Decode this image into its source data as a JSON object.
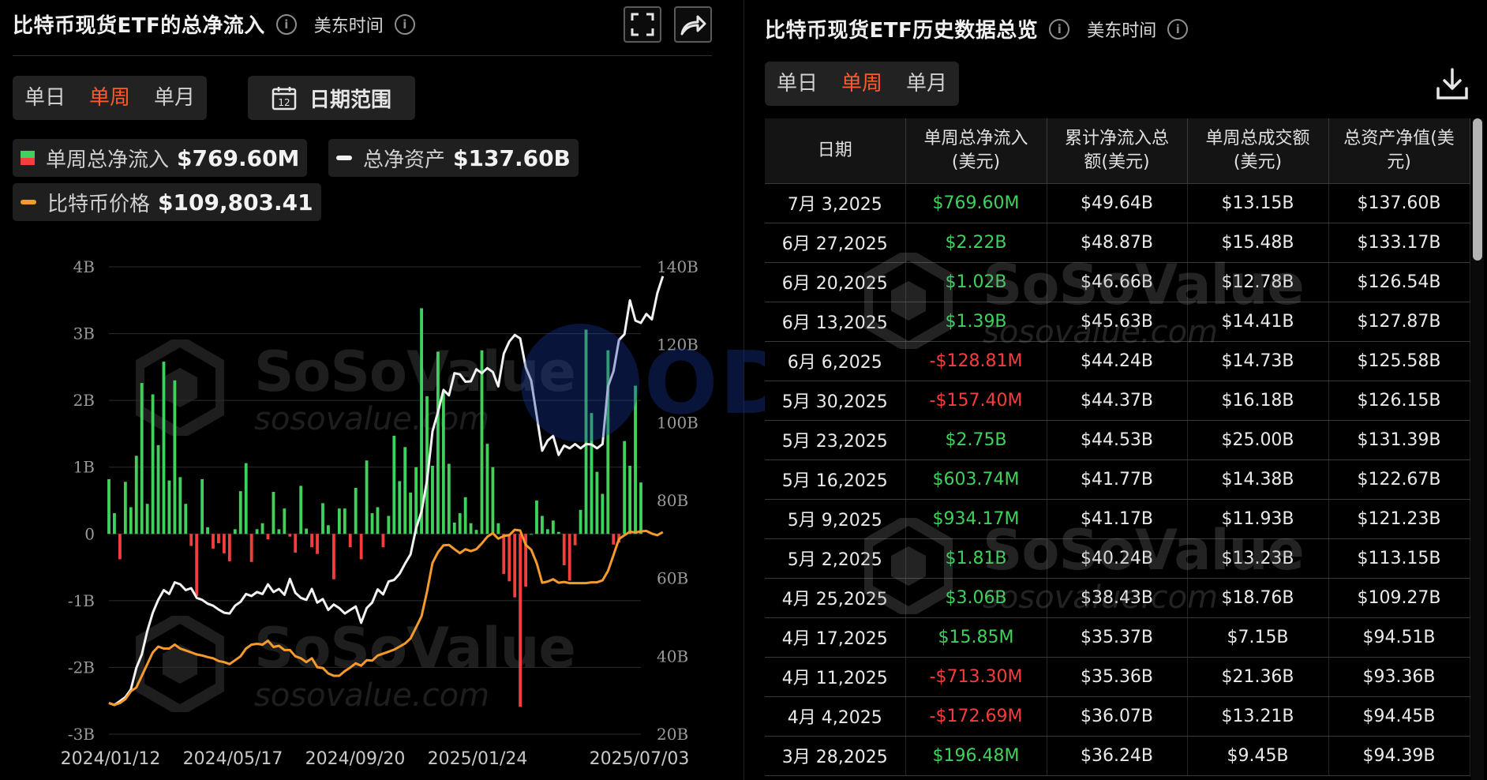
{
  "left": {
    "title": "比特币现货ETF的总净流入",
    "tz": "美东时间",
    "tabs": [
      "单日",
      "单周",
      "单月"
    ],
    "active_tab": 1,
    "date_range": "日期范围",
    "calendar_day": "12",
    "legend": {
      "flow_label": "单周总净流入",
      "flow_value": "$769.60M",
      "assets_label": "总净资产",
      "assets_value": "$137.60B",
      "price_label": "比特币价格",
      "price_value": "$109,803.41"
    },
    "watermark": {
      "brand": "SoSoValue",
      "site": "sosovalue.com"
    }
  },
  "right": {
    "title": "比特币现货ETF历史数据总览",
    "tz": "美东时间",
    "tabs": [
      "单日",
      "单周",
      "单月"
    ],
    "active_tab": 1,
    "headers": [
      "日期",
      "单周总净流入\n(美元)",
      "累计净流入总\n额(美元)",
      "单周总成交额\n(美元)",
      "总资产净值(美\n元)"
    ],
    "rows": [
      [
        "7月 3,2025",
        "$769.60M",
        "$49.64B",
        "$13.15B",
        "$137.60B"
      ],
      [
        "6月 27,2025",
        "$2.22B",
        "$48.87B",
        "$15.48B",
        "$133.17B"
      ],
      [
        "6月 20,2025",
        "$1.02B",
        "$46.66B",
        "$12.78B",
        "$126.54B"
      ],
      [
        "6月 13,2025",
        "$1.39B",
        "$45.63B",
        "$14.41B",
        "$127.87B"
      ],
      [
        "6月 6,2025",
        "-$128.81M",
        "$44.24B",
        "$14.73B",
        "$125.58B"
      ],
      [
        "5月 30,2025",
        "-$157.40M",
        "$44.37B",
        "$16.18B",
        "$126.15B"
      ],
      [
        "5月 23,2025",
        "$2.75B",
        "$44.53B",
        "$25.00B",
        "$131.39B"
      ],
      [
        "5月 16,2025",
        "$603.74M",
        "$41.77B",
        "$14.38B",
        "$122.67B"
      ],
      [
        "5月 9,2025",
        "$934.17M",
        "$41.17B",
        "$11.93B",
        "$121.23B"
      ],
      [
        "5月 2,2025",
        "$1.81B",
        "$40.24B",
        "$13.23B",
        "$113.15B"
      ],
      [
        "4月 25,2025",
        "$3.06B",
        "$38.43B",
        "$18.76B",
        "$109.27B"
      ],
      [
        "4月 17,2025",
        "$15.85M",
        "$35.37B",
        "$7.15B",
        "$94.51B"
      ],
      [
        "4月 11,2025",
        "-$713.30M",
        "$35.36B",
        "$21.36B",
        "$93.36B"
      ],
      [
        "4月 4,2025",
        "-$172.69M",
        "$36.07B",
        "$13.21B",
        "$94.45B"
      ],
      [
        "3月 28,2025",
        "$196.48M",
        "$36.24B",
        "$9.45B",
        "$94.39B"
      ]
    ],
    "watermark": {
      "brand": "SoSoValue",
      "site": "sosovalue.com"
    }
  },
  "overlay_watermark": "ODAILY",
  "colors": {
    "up": "#3fd15c",
    "down": "#f43d3d",
    "assets": "#f2f2f2",
    "price": "#f59a2c",
    "accent": "#ff5a2e"
  },
  "chart_data": {
    "type": "bar",
    "left_axis": {
      "ticks": [
        "4B",
        "3B",
        "2B",
        "1B",
        "0",
        "-1B",
        "-2B",
        "-3B"
      ],
      "range": [
        -3,
        4
      ],
      "unit": "B"
    },
    "right_axis": {
      "ticks": [
        "140B",
        "120B",
        "100B",
        "80B",
        "60B",
        "40B",
        "20B"
      ],
      "range": [
        20,
        140
      ],
      "unit": "B"
    },
    "x_ticks": [
      "2024/01/12",
      "2024/05/17",
      "2024/09/20",
      "2025/01/24",
      "2025/07/03"
    ],
    "grid": true,
    "series": [
      {
        "name": "单周总净流入",
        "type": "bar",
        "values": [
          0.82,
          0.31,
          -0.38,
          0.78,
          0.4,
          1.17,
          2.26,
          0.45,
          2.09,
          1.33,
          2.58,
          0.8,
          2.3,
          0.85,
          0.45,
          -0.18,
          -0.93,
          0.82,
          0.1,
          -0.22,
          -0.14,
          -0.29,
          -0.41,
          0.07,
          0.64,
          1.06,
          -0.42,
          0.07,
          0.16,
          -0.08,
          0.63,
          0.07,
          0.38,
          -0.04,
          -0.28,
          0.72,
          0.08,
          -0.2,
          -0.3,
          0.46,
          0.13,
          -0.68,
          0.38,
          0.38,
          -0.2,
          0.69,
          -0.38,
          1.1,
          0.31,
          0.4,
          -0.2,
          0.27,
          1.47,
          0.79,
          1.3,
          0.62,
          1.0,
          3.38,
          2.06,
          1.02,
          2.73,
          2.12,
          1.05,
          0.17,
          0.31,
          0.55,
          0.16,
          0.06,
          2.75,
          1.35,
          1.0,
          0.16,
          -0.6,
          -0.71,
          -0.95,
          -2.59,
          -0.79,
          0.0,
          0.5,
          0.27,
          0.07,
          0.2,
          0.03,
          -0.47,
          -0.7,
          -0.17,
          0.36,
          3.06,
          1.81,
          0.93,
          0.6,
          2.75,
          -0.16,
          -0.13,
          1.39,
          1.02,
          2.22,
          0.77
        ]
      },
      {
        "name": "总净资产",
        "type": "line",
        "values": [
          28,
          27.5,
          28.5,
          29.5,
          31.5,
          37,
          40.5,
          46.5,
          51.2,
          54.5,
          57,
          56,
          59,
          58.5,
          57,
          57.5,
          55,
          54.5,
          53.5,
          53,
          52,
          51.2,
          51,
          53,
          54,
          56,
          55.5,
          56.5,
          56,
          58.5,
          56.5,
          57.3,
          55.8,
          59.9,
          56.3,
          55,
          54.5,
          57.3,
          53.8,
          54.7,
          51.9,
          53.3,
          52.4,
          51,
          51.9,
          52.8,
          48.6,
          52.4,
          53.8,
          57.2,
          55.9,
          59.2,
          59.6,
          61.2,
          63.8,
          66.2,
          72.8,
          77.2,
          85.1,
          97.8,
          102.7,
          108.4,
          107,
          112.7,
          112.4,
          110.5,
          110.6,
          113.7,
          112.7,
          114,
          113,
          109.3,
          117.7,
          120.8,
          122.5,
          121.6,
          114.2,
          110.8,
          101.8,
          92.8,
          95.4,
          96.6,
          91.7,
          94.1,
          93.4,
          94.5,
          93.4,
          94.5,
          94.4,
          93.4,
          94.5,
          109.3,
          113.2,
          121.2,
          122.7,
          131.4,
          126.2,
          125.6,
          127.9,
          126.5,
          133.2,
          137.6
        ]
      },
      {
        "name": "比特币价格",
        "type": "line",
        "scale": "right_axis",
        "values": [
          28,
          27.5,
          28,
          29,
          31,
          32,
          35,
          38,
          41,
          42.5,
          42,
          42,
          43,
          42,
          41.5,
          41,
          40.5,
          40.2,
          39.8,
          39.5,
          38.8,
          38.5,
          38,
          39,
          40,
          42,
          43,
          43.2,
          43,
          44,
          42.4,
          42.7,
          41.6,
          41.6,
          40,
          39.5,
          38.5,
          39.5,
          37.2,
          37,
          35.6,
          35,
          35,
          36.2,
          37.1,
          38.2,
          37.6,
          39,
          38.9,
          40.2,
          40.7,
          41.2,
          41.7,
          42.5,
          43.3,
          44.6,
          47.4,
          50.3,
          56.6,
          64,
          66.7,
          68.5,
          68.6,
          67.5,
          66.5,
          67.5,
          67,
          67.5,
          69,
          70.7,
          71.6,
          70.2,
          70.9,
          71.1,
          72.5,
          72.3,
          68.6,
          67.4,
          63.9,
          58.9,
          59.2,
          59.8,
          58.9,
          59.1,
          58.8,
          58.8,
          58.8,
          58.8,
          59,
          59,
          59.5,
          61.9,
          66,
          70.1,
          71.1,
          72,
          71.8,
          72.1,
          72.2,
          71.5,
          71.1,
          71.9
        ]
      }
    ]
  }
}
